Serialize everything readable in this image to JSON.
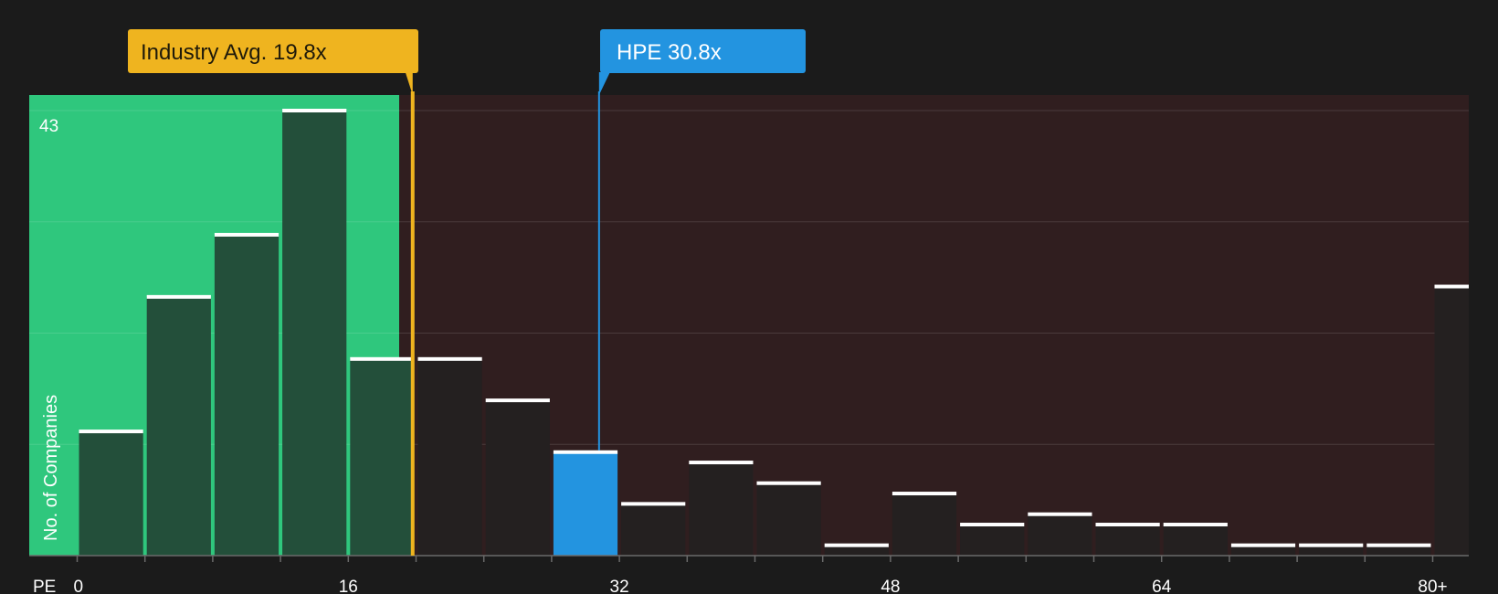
{
  "chart_data": {
    "type": "bar",
    "x_axis_label": "PE",
    "y_axis_label": "No. of Companies",
    "y_max_label": "43",
    "y_max": 43,
    "x_ticks": [
      "0",
      "16",
      "32",
      "48",
      "64",
      "80+"
    ],
    "bin_width": 4,
    "values": [
      12,
      25,
      31,
      43,
      19,
      19,
      15,
      10,
      5,
      9,
      7,
      1,
      6,
      3,
      4,
      3,
      3,
      1,
      1,
      1,
      26
    ],
    "highlighted_bin": 7,
    "industry_avg": {
      "label": "Industry Avg. 19.8x",
      "value": 19.8
    },
    "company": {
      "label": "HPE 30.8x",
      "value": 30.8
    },
    "colors": {
      "background": "#1b1b1b",
      "good_region": "#2fc77d",
      "bad_region": "#301e1f",
      "bar_in_good": "#234f3a",
      "bar_in_bad": "#242020",
      "bar_highlight": "#2394e0",
      "industry": "#efb41f",
      "company": "#2394e0",
      "cap": "#ffffff"
    }
  }
}
